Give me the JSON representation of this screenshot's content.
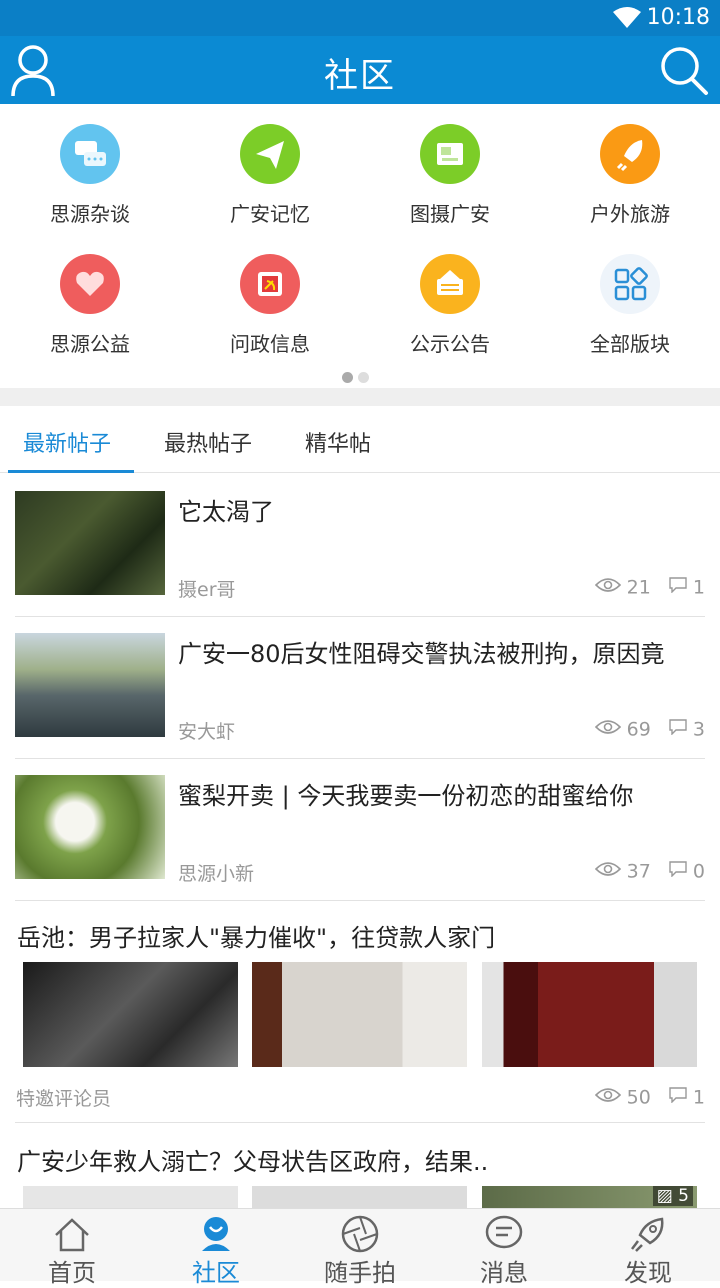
{
  "status": {
    "time": "10:18"
  },
  "header": {
    "title": "社区"
  },
  "sections": [
    {
      "label": "思源杂谈",
      "color": "#62c4ef",
      "icon": "chat-bubbles-icon"
    },
    {
      "label": "广安记忆",
      "color": "#7ccd28",
      "icon": "paper-plane-icon"
    },
    {
      "label": "图摄广安",
      "color": "#7ccd28",
      "icon": "photo-icon"
    },
    {
      "label": "户外旅游",
      "color": "#fa9a14",
      "icon": "rocket-icon"
    },
    {
      "label": "思源公益",
      "color": "#ef5d5d",
      "icon": "heart-icon"
    },
    {
      "label": "问政信息",
      "color": "#ef5d5d",
      "icon": "party-emblem-icon"
    },
    {
      "label": "公示公告",
      "color": "#fab31e",
      "icon": "notice-board-icon"
    },
    {
      "label": "全部版块",
      "color": "#2a8fd6",
      "icon": "grid-icon"
    }
  ],
  "tabs": [
    "最新帖子",
    "最热帖子",
    "精华帖"
  ],
  "posts": [
    {
      "title": "它太渴了",
      "author": "摄er哥",
      "views": "21",
      "comments": "1"
    },
    {
      "title": "广安一80后女性阻碍交警执法被刑拘，原因竟",
      "author": "安大虾",
      "views": "69",
      "comments": "3"
    },
    {
      "title": "蜜梨开卖 | 今天我要卖一份初恋的甜蜜给你",
      "author": "思源小新",
      "views": "37",
      "comments": "0"
    },
    {
      "title": "岳池：男子拉家人\"暴力催收\"，往贷款人家门",
      "author": "特邀评论员",
      "views": "50",
      "comments": "1"
    },
    {
      "title": "广安少年救人溺亡？父母状告区政府，结果..",
      "image_count": "5"
    }
  ],
  "nav": [
    "首页",
    "社区",
    "随手拍",
    "消息",
    "发现"
  ]
}
